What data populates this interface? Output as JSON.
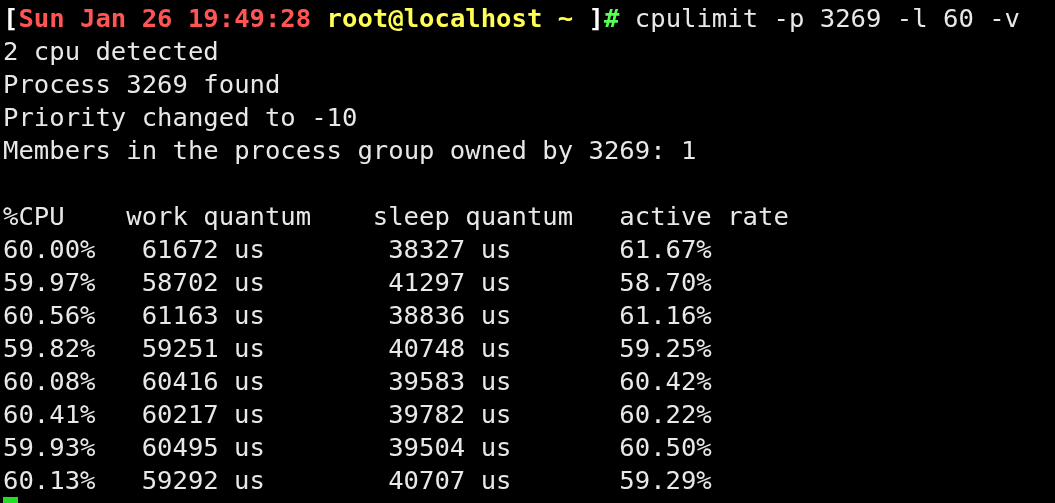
{
  "prompt": {
    "open": "[",
    "time": "Sun Jan 26 19:49:28",
    "user_host": "root@localhost ~",
    "close": "]",
    "symbol": "#",
    "command": "cpulimit -p 3269 -l 60 -v"
  },
  "output": [
    "2 cpu detected",
    "Process 3269 found",
    "Priority changed to -10",
    "Members in the process group owned by 3269: 1"
  ],
  "table": {
    "columns": [
      "%CPU",
      "work quantum",
      "sleep quantum",
      "active rate"
    ],
    "rows": [
      [
        "60.00%",
        "61672 us",
        "38327 us",
        "61.67%"
      ],
      [
        "59.97%",
        "58702 us",
        "41297 us",
        "58.70%"
      ],
      [
        "60.56%",
        "61163 us",
        "38836 us",
        "61.16%"
      ],
      [
        "59.82%",
        "59251 us",
        "40748 us",
        "59.25%"
      ],
      [
        "60.08%",
        "60416 us",
        "39583 us",
        "60.42%"
      ],
      [
        "60.41%",
        "60217 us",
        "39782 us",
        "60.22%"
      ],
      [
        "59.93%",
        "60495 us",
        "39504 us",
        "60.50%"
      ],
      [
        "60.13%",
        "59292 us",
        "40707 us",
        "59.29%"
      ]
    ]
  }
}
